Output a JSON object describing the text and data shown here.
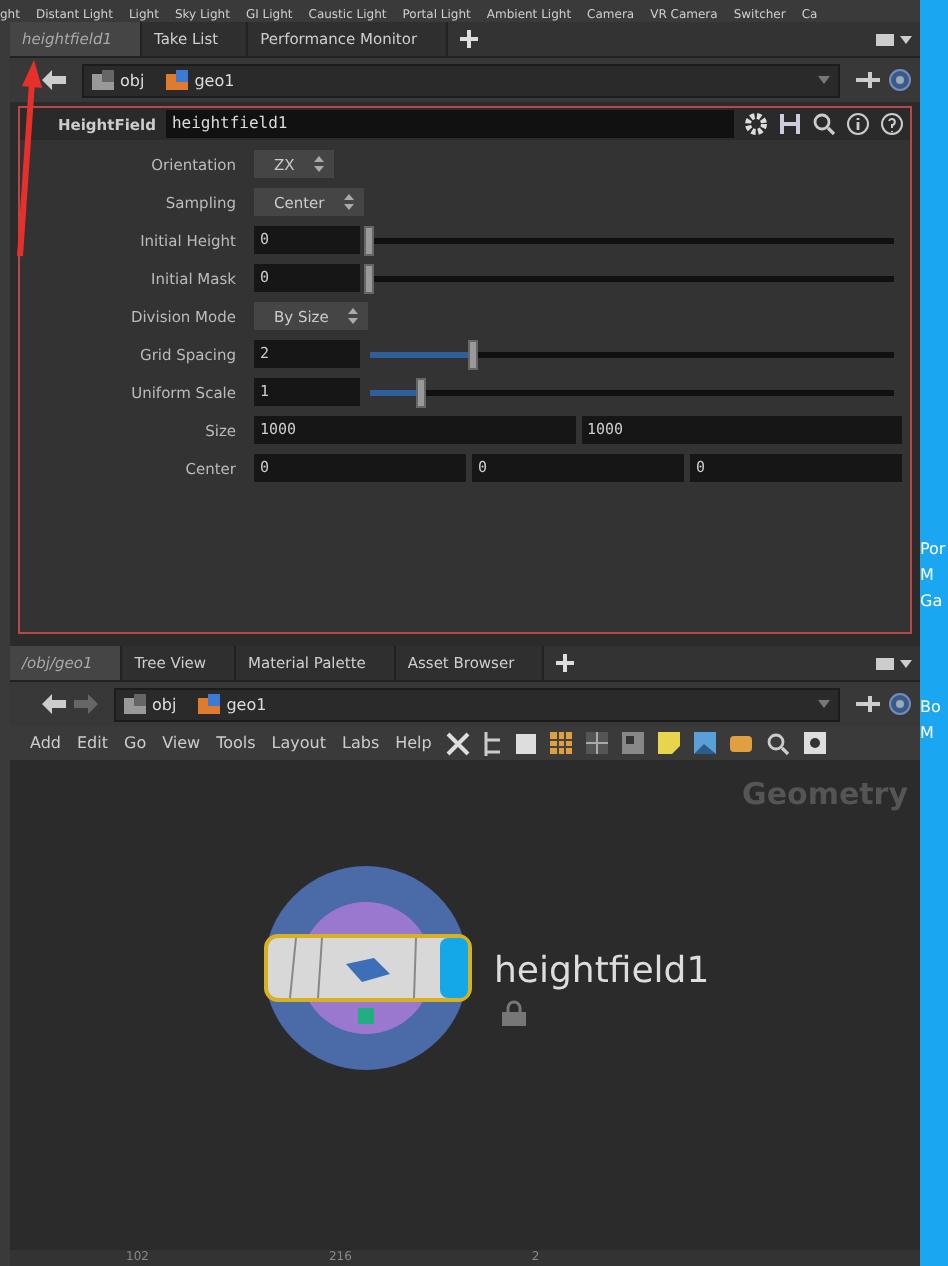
{
  "shelf": [
    "ght",
    "Distant Light",
    "Light",
    "Sky Light",
    "GI Light",
    "Caustic Light",
    "Portal Light",
    "Ambient Light",
    "Camera",
    "VR Camera",
    "Switcher",
    "Ca"
  ],
  "top_tabs": [
    {
      "label": "heightfield1",
      "selected": true
    },
    {
      "label": "Take List",
      "selected": false
    },
    {
      "label": "Performance Monitor",
      "selected": false
    }
  ],
  "top_path": [
    "obj",
    "geo1"
  ],
  "parameters": {
    "node_type": "HeightField",
    "node_name": "heightfield1",
    "params": [
      {
        "kind": "menu",
        "label": "Orientation",
        "value": "ZX"
      },
      {
        "kind": "menu",
        "label": "Sampling",
        "value": "Center"
      },
      {
        "kind": "slider",
        "label": "Initial Height",
        "value": "0",
        "level": 0
      },
      {
        "kind": "slider",
        "label": "Initial Mask",
        "value": "0",
        "level": 0
      },
      {
        "kind": "menu",
        "label": "Division Mode",
        "value": "By Size"
      },
      {
        "kind": "slider",
        "label": "Grid Spacing",
        "value": "2",
        "level": 0.2
      },
      {
        "kind": "slider",
        "label": "Uniform Scale",
        "value": "1",
        "level": 0.1
      },
      {
        "kind": "vector",
        "label": "Size",
        "values": [
          "1000",
          "1000"
        ]
      },
      {
        "kind": "vector",
        "label": "Center",
        "values": [
          "0",
          "0",
          "0"
        ]
      }
    ]
  },
  "network_tabs": [
    {
      "label": "/obj/geo1",
      "selected": true
    },
    {
      "label": "Tree View",
      "selected": false
    },
    {
      "label": "Material Palette",
      "selected": false
    },
    {
      "label": "Asset Browser",
      "selected": false
    }
  ],
  "network_path": [
    "obj",
    "geo1"
  ],
  "network_menu": [
    "Add",
    "Edit",
    "Go",
    "View",
    "Tools",
    "Layout",
    "Labs",
    "Help"
  ],
  "network": {
    "context": "Geometry",
    "node": {
      "name": "heightfield1",
      "locked": true
    }
  },
  "status": [
    "102",
    "216",
    "2"
  ],
  "side_strip": [
    "Por",
    "M",
    "Ga",
    "Bo",
    "M"
  ]
}
